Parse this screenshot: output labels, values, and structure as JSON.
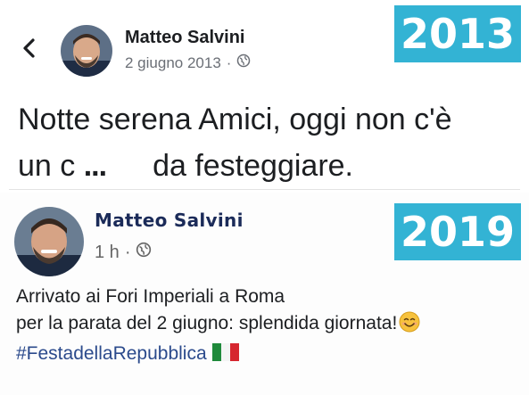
{
  "post_2013": {
    "author": "Matteo Salvini",
    "date": "2 giugno 2013",
    "separator": "·",
    "year_badge": "2013",
    "text_line1": "Notte serena Amici, oggi non c'è",
    "text_line2_start": "un c",
    "text_line2_ellipsis": "...",
    "text_line2_end": "da festeggiare."
  },
  "post_2019": {
    "author": "Matteo Salvini",
    "time": "1 h",
    "separator": "·",
    "year_badge": "2019",
    "text_line1": "Arrivato ai Fori Imperiali a Roma",
    "text_line2": "per la parata del 2 giugno: splendida giornata!",
    "hashtag": "#FestadellaRepubblica"
  },
  "icons": {
    "back": "chevron-left-icon",
    "privacy": "globe-icon",
    "emoji": "smiling-face-icon",
    "flag": "italian-flag-icon"
  },
  "colors": {
    "badge": "#33b3d4",
    "hashtag": "#2b4a8c"
  }
}
